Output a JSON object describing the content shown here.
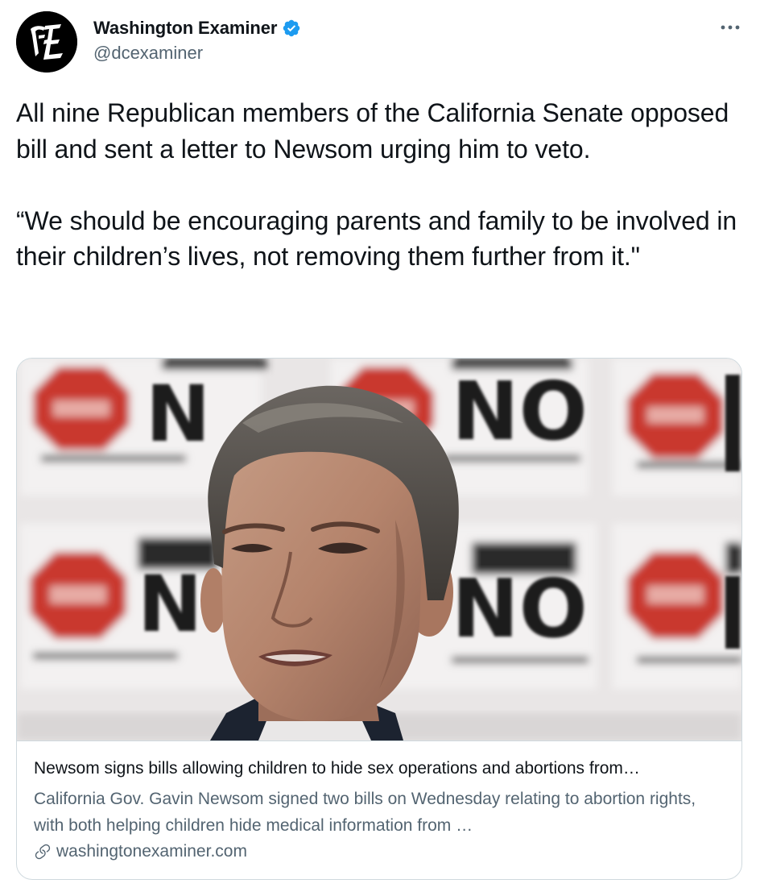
{
  "author": {
    "display_name": "Washington Examiner",
    "handle": "@dcexaminer",
    "avatar_icon": "washington-examiner-logo",
    "verified": true,
    "verified_color": "#1d9bf0"
  },
  "more_icon": "more-dots-icon",
  "tweet": {
    "text": "All nine Republican members of the California Senate opposed bill and sent a letter to Newsom urging him to veto.\n\n“We should be encouraging parents and family to be involved in their children’s lives, not removing them further from it.\""
  },
  "card": {
    "image_description_icon": "article-photo",
    "title": "Newsom signs bills allowing children to hide sex operations and abortions from…",
    "description": "California Gov. Gavin Newsom signed two bills on Wednesday relating to abortion rights, with both helping children hide medical information from …",
    "domain": "washingtonexaminer.com",
    "domain_icon": "link-icon",
    "photo_sign_text": "NO"
  },
  "colors": {
    "text_primary": "#0f1419",
    "text_secondary": "#536471",
    "border": "#cfd9de",
    "accent": "#1d9bf0"
  }
}
